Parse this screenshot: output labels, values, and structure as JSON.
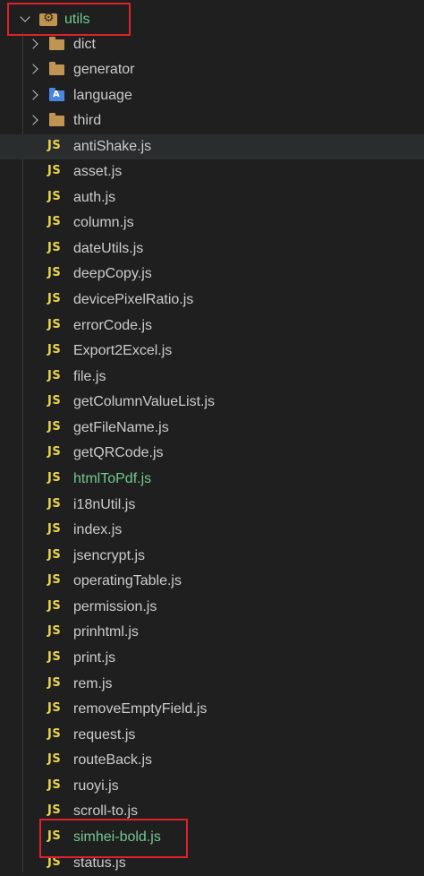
{
  "root": {
    "label": "utils",
    "expanded": true,
    "icon": "utils-folder-icon"
  },
  "folders": [
    {
      "label": "dict",
      "icon": "folder-icon"
    },
    {
      "label": "generator",
      "icon": "folder-icon"
    },
    {
      "label": "language",
      "icon": "language-folder-icon"
    },
    {
      "label": "third",
      "icon": "folder-icon"
    }
  ],
  "js_badge": "JS",
  "files": [
    {
      "label": "antiShake.js"
    },
    {
      "label": "asset.js"
    },
    {
      "label": "auth.js"
    },
    {
      "label": "column.js"
    },
    {
      "label": "dateUtils.js"
    },
    {
      "label": "deepCopy.js"
    },
    {
      "label": "devicePixelRatio.js"
    },
    {
      "label": "errorCode.js"
    },
    {
      "label": "Export2Excel.js"
    },
    {
      "label": "file.js"
    },
    {
      "label": "getColumnValueList.js"
    },
    {
      "label": "getFileName.js"
    },
    {
      "label": "getQRCode.js"
    },
    {
      "label": "htmlToPdf.js"
    },
    {
      "label": "i18nUtil.js"
    },
    {
      "label": "index.js"
    },
    {
      "label": "jsencrypt.js"
    },
    {
      "label": "operatingTable.js"
    },
    {
      "label": "permission.js"
    },
    {
      "label": "prinhtml.js"
    },
    {
      "label": "print.js"
    },
    {
      "label": "rem.js"
    },
    {
      "label": "removeEmptyField.js"
    },
    {
      "label": "request.js"
    },
    {
      "label": "routeBack.js"
    },
    {
      "label": "ruoyi.js"
    },
    {
      "label": "scroll-to.js"
    },
    {
      "label": "simhei-bold.js"
    },
    {
      "label": "status.js"
    }
  ],
  "colors": {
    "background": "#1f1f1f",
    "text": "#cccccc",
    "modified_text": "#73c991",
    "js_badge": "#e8d44d",
    "folder": "#c09553",
    "selected_row": "#2a2d2e",
    "highlight_box": "#e0202a"
  }
}
